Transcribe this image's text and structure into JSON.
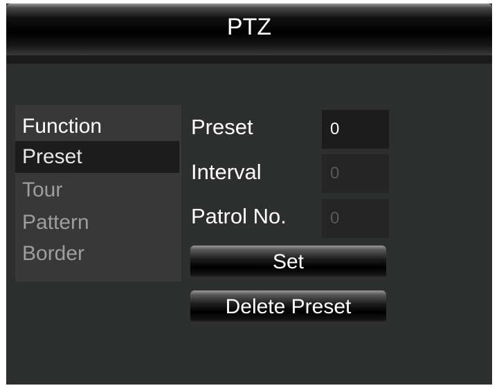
{
  "window": {
    "title": "PTZ"
  },
  "sidebar": {
    "header": "Function",
    "items": [
      {
        "label": "Preset",
        "selected": true
      },
      {
        "label": "Tour",
        "selected": false
      },
      {
        "label": "Pattern",
        "selected": false
      },
      {
        "label": "Border",
        "selected": false
      }
    ]
  },
  "form": {
    "preset": {
      "label": "Preset",
      "value": "0",
      "enabled": true
    },
    "interval": {
      "label": "Interval",
      "value": "0",
      "enabled": false
    },
    "patrol_no": {
      "label": "Patrol No.",
      "value": "0",
      "enabled": false
    }
  },
  "buttons": {
    "set_label": "Set",
    "delete_preset_label": "Delete Preset"
  },
  "colors": {
    "background": "#2d2f2e",
    "selected_item": "#1c1c1c",
    "text_active": "#ffffff",
    "text_inactive": "#9e9e9e"
  }
}
